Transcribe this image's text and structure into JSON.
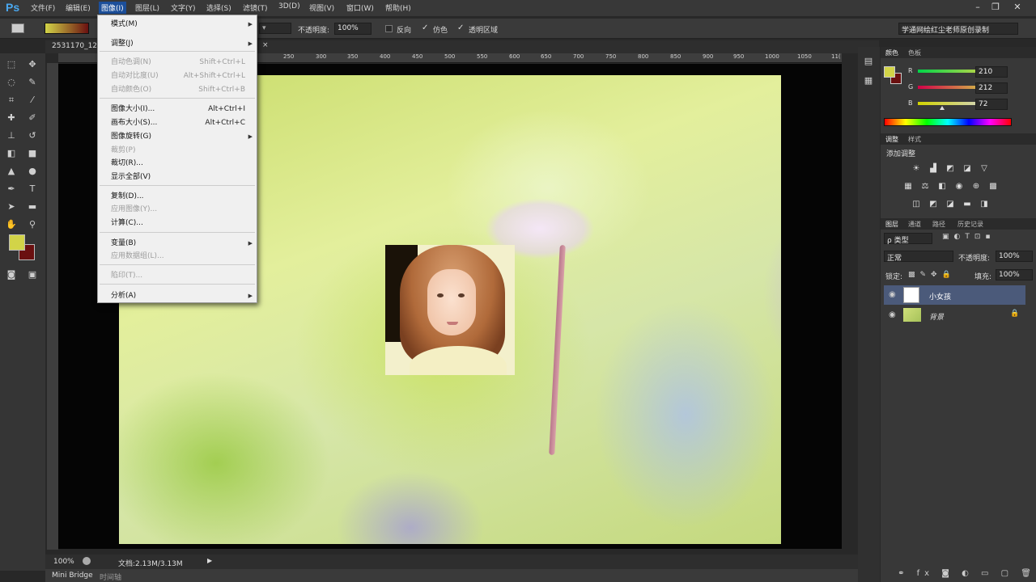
{
  "app": {
    "logo": "Ps"
  },
  "menubar": [
    "文件(F)",
    "编辑(E)",
    "图像(I)",
    "图层(L)",
    "文字(Y)",
    "选择(S)",
    "滤镜(T)",
    "3D(D)",
    "视图(V)",
    "窗口(W)",
    "帮助(H)"
  ],
  "window_controls": {
    "min": "–",
    "restore": "❐",
    "close": "✕"
  },
  "options": {
    "opacity_label": "不透明度:",
    "opacity_value": "100%",
    "reverse": "反向",
    "dither": "仿色",
    "transparency": "透明区域",
    "workspace": "学通网绘红尘老师原创录制"
  },
  "doc_tab": "2531170_12",
  "ruler_ticks": [
    "250",
    "300",
    "350",
    "400",
    "450",
    "500",
    "550",
    "600",
    "650",
    "700",
    "750",
    "800",
    "850",
    "900",
    "950",
    "1000",
    "1050",
    "11("
  ],
  "image_menu": {
    "items": [
      {
        "label": "模式(M)",
        "shortcut": "",
        "submenu": true,
        "disabled": false
      },
      {
        "label": "调整(J)",
        "shortcut": "",
        "submenu": true,
        "disabled": false
      },
      {
        "label": "自动色调(N)",
        "shortcut": "Shift+Ctrl+L",
        "submenu": false,
        "disabled": true
      },
      {
        "label": "自动对比度(U)",
        "shortcut": "Alt+Shift+Ctrl+L",
        "submenu": false,
        "disabled": true
      },
      {
        "label": "自动颜色(O)",
        "shortcut": "Shift+Ctrl+B",
        "submenu": false,
        "disabled": true
      },
      {
        "label": "图像大小(I)...",
        "shortcut": "Alt+Ctrl+I",
        "submenu": false,
        "disabled": false
      },
      {
        "label": "画布大小(S)...",
        "shortcut": "Alt+Ctrl+C",
        "submenu": false,
        "disabled": false
      },
      {
        "label": "图像旋转(G)",
        "shortcut": "",
        "submenu": true,
        "disabled": false
      },
      {
        "label": "裁剪(P)",
        "shortcut": "",
        "submenu": false,
        "disabled": true
      },
      {
        "label": "裁切(R)...",
        "shortcut": "",
        "submenu": false,
        "disabled": false
      },
      {
        "label": "显示全部(V)",
        "shortcut": "",
        "submenu": false,
        "disabled": false
      },
      {
        "label": "复制(D)...",
        "shortcut": "",
        "submenu": false,
        "disabled": false
      },
      {
        "label": "应用图像(Y)...",
        "shortcut": "",
        "submenu": false,
        "disabled": true
      },
      {
        "label": "计算(C)...",
        "shortcut": "",
        "submenu": false,
        "disabled": false
      },
      {
        "label": "变量(B)",
        "shortcut": "",
        "submenu": true,
        "disabled": false
      },
      {
        "label": "应用数据组(L)...",
        "shortcut": "",
        "submenu": false,
        "disabled": true
      },
      {
        "label": "陷印(T)...",
        "shortcut": "",
        "submenu": false,
        "disabled": true
      },
      {
        "label": "分析(A)",
        "shortcut": "",
        "submenu": true,
        "disabled": false
      }
    ]
  },
  "status": {
    "zoom": "100%",
    "doc": "文档:2.13M/3.13M"
  },
  "bottom_tabs": [
    "Mini Bridge",
    "时间轴"
  ],
  "color_panel": {
    "tabs": [
      "颜色",
      "色板"
    ],
    "R": "210",
    "G": "212",
    "B": "72",
    "foreground": "#d2d448",
    "background": "#6a1010"
  },
  "adjust_panel": {
    "tabs": [
      "调整",
      "样式"
    ],
    "title": "添加调整"
  },
  "layers_panel": {
    "tabs": [
      "图层",
      "通道",
      "路径",
      "历史记录"
    ],
    "filter": "ρ 类型",
    "blend": "正常",
    "opacity_label": "不透明度:",
    "opacity": "100%",
    "lock_label": "锁定:",
    "fill_label": "填充:",
    "fill": "100%",
    "layers": [
      {
        "name": "小女孩",
        "selected": true
      },
      {
        "name": "背景",
        "selected": false
      }
    ]
  }
}
